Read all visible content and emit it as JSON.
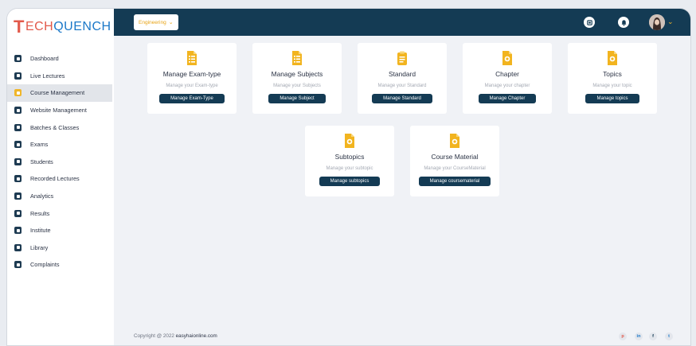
{
  "logo": {
    "t": "T",
    "p1": "ECH",
    "p2": "QUENCH"
  },
  "topbar": {
    "dept": "Engineering"
  },
  "sidebar": {
    "items": [
      {
        "label": "Dashboard",
        "active": false
      },
      {
        "label": "Live Lectures",
        "active": false
      },
      {
        "label": "Course Management",
        "active": true
      },
      {
        "label": "Website Management",
        "active": false
      },
      {
        "label": "Batches & Classes",
        "active": false
      },
      {
        "label": "Exams",
        "active": false
      },
      {
        "label": "Students",
        "active": false
      },
      {
        "label": "Recorded Lectures",
        "active": false
      },
      {
        "label": "Analytics",
        "active": false
      },
      {
        "label": "Results",
        "active": false
      },
      {
        "label": "Institute",
        "active": false
      },
      {
        "label": "Library",
        "active": false
      },
      {
        "label": "Complaints",
        "active": false
      }
    ]
  },
  "cards": [
    {
      "title": "Manage Exam-type",
      "sub": "Manage your Exam-type",
      "btn": "Manage Exam-Type",
      "icon": "list-document-icon"
    },
    {
      "title": "Manage Subjects",
      "sub": "Manage your Subjects",
      "btn": "Manage Subject",
      "icon": "list-document-icon"
    },
    {
      "title": "Standard",
      "sub": "Manage your Standard",
      "btn": "Manage Standard",
      "icon": "clipboard-icon"
    },
    {
      "title": "Chapter",
      "sub": "Manage your chapter",
      "btn": "Manage Chapter",
      "icon": "document-badge-icon"
    },
    {
      "title": "Topics",
      "sub": "Manage your topic",
      "btn": "Manage topics",
      "icon": "document-badge-icon"
    },
    {
      "title": "Subtopics",
      "sub": "Manage your subtopic",
      "btn": "Manage subtopics",
      "icon": "document-badge-icon"
    },
    {
      "title": "Course Material",
      "sub": "Manage your CourseMaterial",
      "btn": "Manage coursematerial",
      "icon": "document-badge-icon"
    }
  ],
  "footer": {
    "copy": "Copyright @ 2022",
    "site": "easyhaionline.com",
    "social": [
      "p",
      "in",
      "f",
      "t"
    ]
  },
  "colors": {
    "navy": "#143b54",
    "accent": "#f0b62a",
    "brand_red": "#e25a4b",
    "brand_blue": "#1b78c8"
  }
}
